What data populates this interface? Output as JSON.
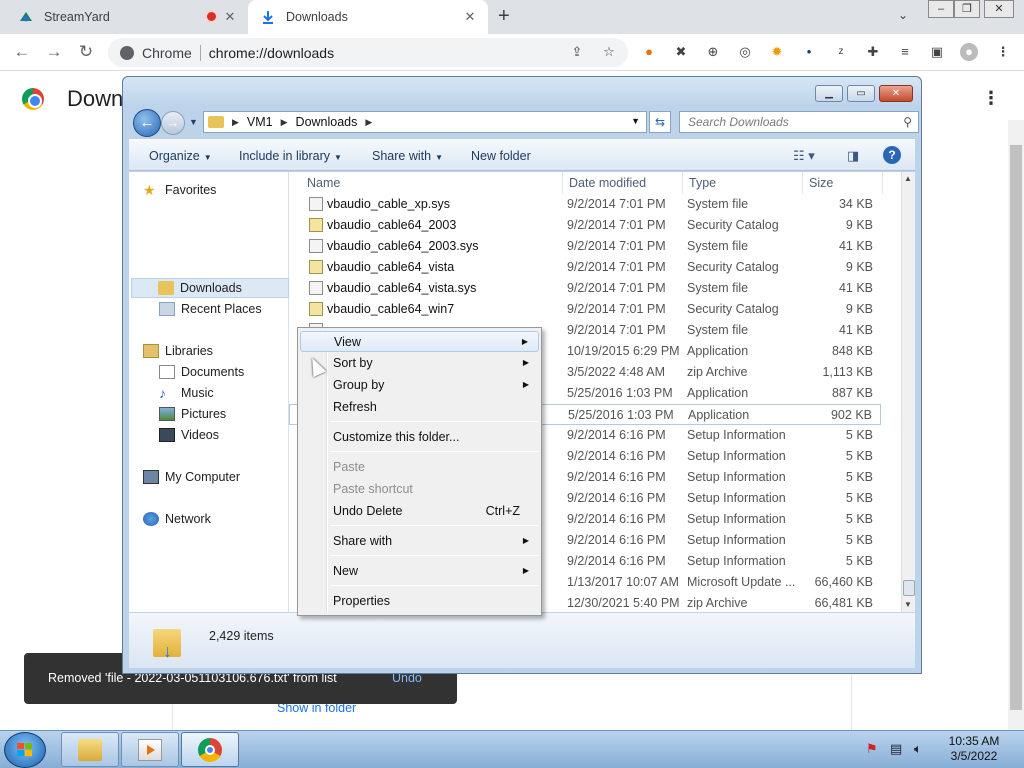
{
  "chrome": {
    "tabs": [
      {
        "label": "StreamYard",
        "icon": "streamyard-icon"
      },
      {
        "label": "Downloads",
        "icon": "download-icon"
      }
    ],
    "omnibox": {
      "site": "Chrome",
      "url": "chrome://downloads"
    },
    "page_title": "Down",
    "show_in_folder": "Show in folder",
    "toast": {
      "message": "Removed 'file - 2022-03-051103106.676.txt' from list",
      "undo": "Undo"
    }
  },
  "explorer": {
    "breadcrumb": [
      "VM1",
      "Downloads"
    ],
    "search_placeholder": "Search Downloads",
    "commands": [
      "Organize",
      "Include in library",
      "Share with",
      "New folder"
    ],
    "nav": {
      "favorites": "Favorites",
      "downloads": "Downloads",
      "recent": "Recent Places",
      "libraries": "Libraries",
      "documents": "Documents",
      "music": "Music",
      "pictures": "Pictures",
      "videos": "Videos",
      "computer": "My Computer",
      "network": "Network"
    },
    "columns": {
      "name": "Name",
      "date": "Date modified",
      "type": "Type",
      "size": "Size"
    },
    "files": [
      {
        "name": "vbaudio_cable_xp.sys",
        "date": "9/2/2014 7:01 PM",
        "type": "System file",
        "size": "34 KB",
        "icon": "sys"
      },
      {
        "name": "vbaudio_cable64_2003",
        "date": "9/2/2014 7:01 PM",
        "type": "Security Catalog",
        "size": "9 KB",
        "icon": "cat"
      },
      {
        "name": "vbaudio_cable64_2003.sys",
        "date": "9/2/2014 7:01 PM",
        "type": "System file",
        "size": "41 KB",
        "icon": "sys"
      },
      {
        "name": "vbaudio_cable64_vista",
        "date": "9/2/2014 7:01 PM",
        "type": "Security Catalog",
        "size": "9 KB",
        "icon": "cat"
      },
      {
        "name": "vbaudio_cable64_vista.sys",
        "date": "9/2/2014 7:01 PM",
        "type": "System file",
        "size": "41 KB",
        "icon": "sys"
      },
      {
        "name": "vbaudio_cable64_win7",
        "date": "9/2/2014 7:01 PM",
        "type": "Security Catalog",
        "size": "9 KB",
        "icon": "cat"
      },
      {
        "name": "",
        "date": "9/2/2014 7:01 PM",
        "type": "System file",
        "size": "41 KB",
        "icon": "sys"
      },
      {
        "name": "",
        "date": "10/19/2015 6:29 PM",
        "type": "Application",
        "size": "848 KB",
        "icon": "sys"
      },
      {
        "name": "",
        "date": "3/5/2022 4:48 AM",
        "type": "zip Archive",
        "size": "1,113 KB",
        "icon": "sys"
      },
      {
        "name": "",
        "date": "5/25/2016 1:03 PM",
        "type": "Application",
        "size": "887 KB",
        "icon": "sys"
      },
      {
        "name": "",
        "date": "5/25/2016 1:03 PM",
        "type": "Application",
        "size": "902 KB",
        "icon": "sys"
      },
      {
        "name": "",
        "date": "9/2/2014 6:16 PM",
        "type": "Setup Information",
        "size": "5 KB",
        "icon": "sys"
      },
      {
        "name": "",
        "date": "9/2/2014 6:16 PM",
        "type": "Setup Information",
        "size": "5 KB",
        "icon": "sys"
      },
      {
        "name": "",
        "date": "9/2/2014 6:16 PM",
        "type": "Setup Information",
        "size": "5 KB",
        "icon": "sys"
      },
      {
        "name": "",
        "date": "9/2/2014 6:16 PM",
        "type": "Setup Information",
        "size": "5 KB",
        "icon": "sys"
      },
      {
        "name": "",
        "date": "9/2/2014 6:16 PM",
        "type": "Setup Information",
        "size": "5 KB",
        "icon": "sys"
      },
      {
        "name": "",
        "date": "9/2/2014 6:16 PM",
        "type": "Setup Information",
        "size": "5 KB",
        "icon": "sys"
      },
      {
        "name": "",
        "date": "9/2/2014 6:16 PM",
        "type": "Setup Information",
        "size": "5 KB",
        "icon": "sys"
      },
      {
        "name": "",
        "date": "1/13/2017 10:07 AM",
        "type": "Microsoft Update ...",
        "size": "66,460 KB",
        "icon": "sys"
      },
      {
        "name": "",
        "date": "12/30/2021 5:40 PM",
        "type": "zip Archive",
        "size": "66,481 KB",
        "icon": "sys"
      }
    ],
    "item_count": "2,429 items"
  },
  "context_menu": {
    "view": "View",
    "sort_by": "Sort by",
    "group_by": "Group by",
    "refresh": "Refresh",
    "customize": "Customize this folder...",
    "paste": "Paste",
    "paste_shortcut": "Paste shortcut",
    "undo_delete": "Undo Delete",
    "undo_shortcut": "Ctrl+Z",
    "share_with": "Share with",
    "new": "New",
    "properties": "Properties"
  },
  "taskbar": {
    "time": "10:35 AM",
    "date": "3/5/2022"
  }
}
